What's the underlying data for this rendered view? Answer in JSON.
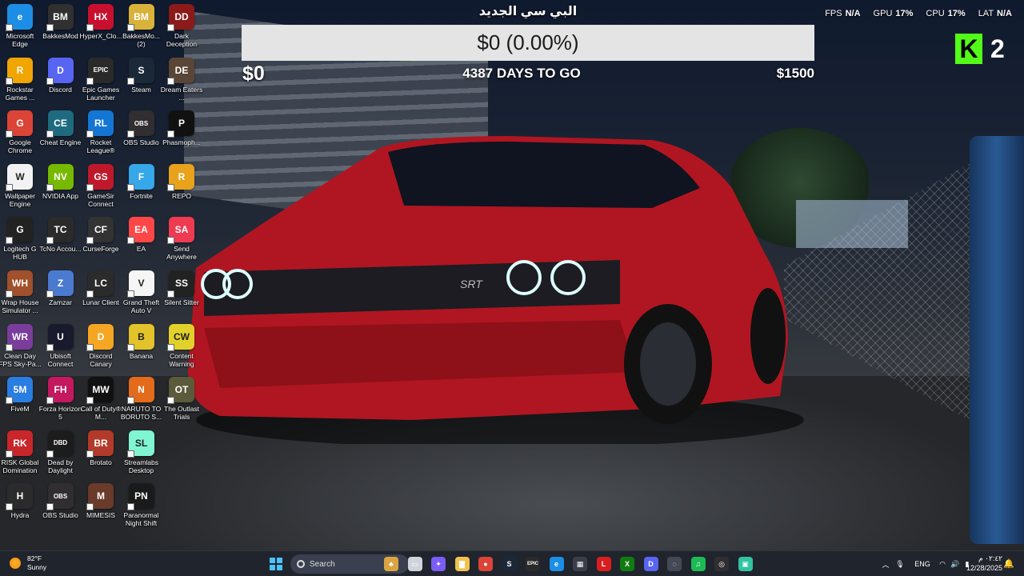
{
  "desktop_icons": [
    {
      "label": "Microsoft Edge",
      "glyph": "e",
      "color": "#1c8ee5",
      "col": 0,
      "row": 0
    },
    {
      "label": "BakkesMod",
      "glyph": "BM",
      "color": "#303030",
      "col": 1,
      "row": 0
    },
    {
      "label": "HyperX_Clo...",
      "glyph": "HX",
      "color": "#c8102e",
      "col": 2,
      "row": 0
    },
    {
      "label": "BakkesMo... (2)",
      "glyph": "BM",
      "color": "#d8b23a",
      "col": 3,
      "row": 0
    },
    {
      "label": "Dark Deception",
      "glyph": "DD",
      "color": "#8b1a1a",
      "col": 4,
      "row": 0
    },
    {
      "label": "Rockstar Games ...",
      "glyph": "R",
      "color": "#f0a500",
      "col": 0,
      "row": 1
    },
    {
      "label": "Discord",
      "glyph": "D",
      "color": "#5865f2",
      "col": 1,
      "row": 1
    },
    {
      "label": "Epic Games Launcher",
      "glyph": "EPIC",
      "color": "#2a2a2a",
      "col": 2,
      "row": 1
    },
    {
      "label": "Steam",
      "glyph": "S",
      "color": "#1b2838",
      "col": 3,
      "row": 1
    },
    {
      "label": "Dream Eaters ...",
      "glyph": "DE",
      "color": "#5a4636",
      "col": 4,
      "row": 1
    },
    {
      "label": "Google Chrome",
      "glyph": "G",
      "color": "#db4437",
      "col": 0,
      "row": 2
    },
    {
      "label": "Cheat Engine",
      "glyph": "CE",
      "color": "#1e6b80",
      "col": 1,
      "row": 2
    },
    {
      "label": "Rocket League®",
      "glyph": "RL",
      "color": "#1476d4",
      "col": 2,
      "row": 2
    },
    {
      "label": "OBS Studio",
      "glyph": "OBS",
      "color": "#302e31",
      "col": 3,
      "row": 2
    },
    {
      "label": "Phasmoph...",
      "glyph": "P",
      "color": "#111111",
      "col": 4,
      "row": 2
    },
    {
      "label": "Wallpaper Engine",
      "glyph": "W",
      "color": "#f2f2f2",
      "col": 0,
      "row": 3
    },
    {
      "label": "NVIDIA App",
      "glyph": "NV",
      "color": "#76b900",
      "col": 1,
      "row": 3
    },
    {
      "label": "GameSir Connect",
      "glyph": "GS",
      "color": "#c0182b",
      "col": 2,
      "row": 3
    },
    {
      "label": "Fortnite",
      "glyph": "F",
      "color": "#36a7e8",
      "col": 3,
      "row": 3
    },
    {
      "label": "REPO",
      "glyph": "R",
      "color": "#e8a21c",
      "col": 4,
      "row": 3
    },
    {
      "label": "Logitech G HUB",
      "glyph": "G",
      "color": "#222222",
      "col": 0,
      "row": 4
    },
    {
      "label": "TcNo Accou...",
      "glyph": "TC",
      "color": "#2b2b2b",
      "col": 1,
      "row": 4
    },
    {
      "label": "CurseForge",
      "glyph": "CF",
      "color": "#333333",
      "col": 2,
      "row": 4
    },
    {
      "label": "EA",
      "glyph": "EA",
      "color": "#ff4747",
      "col": 3,
      "row": 4
    },
    {
      "label": "Send Anywhere",
      "glyph": "SA",
      "color": "#ef3b52",
      "col": 4,
      "row": 4
    },
    {
      "label": "Wrap House Simulator ...",
      "glyph": "WH",
      "color": "#a0502a",
      "col": 0,
      "row": 5
    },
    {
      "label": "Zamzar",
      "glyph": "Z",
      "color": "#4a7bd0",
      "col": 1,
      "row": 5
    },
    {
      "label": "Lunar Client",
      "glyph": "LC",
      "color": "#2b2b2b",
      "col": 2,
      "row": 5
    },
    {
      "label": "Grand Theft Auto V",
      "glyph": "V",
      "color": "#f5f5f5",
      "col": 3,
      "row": 5
    },
    {
      "label": "Silent Sitter",
      "glyph": "SS",
      "color": "#222222",
      "col": 4,
      "row": 5
    },
    {
      "label": "Clean Day FPS Sky-Pa...",
      "glyph": "WR",
      "color": "#7a3d9b",
      "col": 0,
      "row": 6
    },
    {
      "label": "Ubisoft Connect",
      "glyph": "U",
      "color": "#1a1a2e",
      "col": 1,
      "row": 6
    },
    {
      "label": "Discord Canary",
      "glyph": "D",
      "color": "#f5a623",
      "col": 2,
      "row": 6
    },
    {
      "label": "Banana",
      "glyph": "B",
      "color": "#e3c32b",
      "col": 3,
      "row": 6
    },
    {
      "label": "Content Warning",
      "glyph": "CW",
      "color": "#e2d12a",
      "col": 4,
      "row": 6
    },
    {
      "label": "FiveM",
      "glyph": "5M",
      "color": "#2a7de1",
      "col": 0,
      "row": 7
    },
    {
      "label": "Forza Horizon 5",
      "glyph": "FH",
      "color": "#c4195f",
      "col": 1,
      "row": 7
    },
    {
      "label": "Call of Duty® M...",
      "glyph": "MW",
      "color": "#111111",
      "col": 2,
      "row": 7
    },
    {
      "label": "NARUTO TO BORUTO S...",
      "glyph": "N",
      "color": "#e36b1b",
      "col": 3,
      "row": 7
    },
    {
      "label": "The Outlast Trials",
      "glyph": "OT",
      "color": "#5b5b3b",
      "col": 4,
      "row": 7
    },
    {
      "label": "RISK Global Domination",
      "glyph": "RK",
      "color": "#c9262b",
      "col": 0,
      "row": 8
    },
    {
      "label": "Dead by Daylight",
      "glyph": "DBD",
      "color": "#1c1c1c",
      "col": 1,
      "row": 8
    },
    {
      "label": "Brotato",
      "glyph": "BR",
      "color": "#b23a2a",
      "col": 2,
      "row": 8
    },
    {
      "label": "Streamlabs Desktop",
      "glyph": "SL",
      "color": "#80f5d2",
      "col": 3,
      "row": 8
    },
    {
      "label": "Hydra",
      "glyph": "H",
      "color": "#2b2b2b",
      "col": 0,
      "row": 9
    },
    {
      "label": "OBS Studio",
      "glyph": "OBS",
      "color": "#302e31",
      "col": 1,
      "row": 9
    },
    {
      "label": "MIMESIS",
      "glyph": "M",
      "color": "#6a3a2a",
      "col": 2,
      "row": 9
    },
    {
      "label": "Paranormal Night Shift",
      "glyph": "PN",
      "color": "#1a1a1a",
      "col": 3,
      "row": 9
    }
  ],
  "goal": {
    "title": "البي سي الجديد",
    "current_label": "$0 (0.00%)",
    "progress_fraction": 0,
    "min_label": "$0",
    "countdown": "4387 DAYS TO GO",
    "max_label": "$1500",
    "fill_color": "#53fc18"
  },
  "stats": {
    "fps_label": "FPS",
    "fps_value": "N/A",
    "gpu_label": "GPU",
    "gpu_value": "17%",
    "cpu_label": "CPU",
    "cpu_value": "17%",
    "lat_label": "LAT",
    "lat_value": "N/A"
  },
  "kick": {
    "logo": "K",
    "count": "2",
    "accent": "#53fc18"
  },
  "taskbar": {
    "weather": {
      "temp": "82°F",
      "condition": "Sunny"
    },
    "search_placeholder": "Search",
    "pinned_apps": [
      {
        "name": "widgets-icon",
        "glyph": "♣",
        "color": "#d9a441"
      },
      {
        "name": "task-view-icon",
        "glyph": "▭",
        "color": "#cfd3dc"
      },
      {
        "name": "copilot-icon",
        "glyph": "✦",
        "color": "#7b5cf5"
      },
      {
        "name": "file-explorer-icon",
        "glyph": "▇",
        "color": "#f2c14e"
      },
      {
        "name": "chrome-icon",
        "glyph": "●",
        "color": "#db4437"
      },
      {
        "name": "steam-icon",
        "glyph": "S",
        "color": "#1b2838"
      },
      {
        "name": "epic-games-icon",
        "glyph": "EPIC",
        "color": "#2a2a2a"
      },
      {
        "name": "edge-icon",
        "glyph": "e",
        "color": "#1c8ee5"
      },
      {
        "name": "microsoft-store-icon",
        "glyph": "▦",
        "color": "#3a3f4a"
      },
      {
        "name": "l-app-icon",
        "glyph": "L",
        "color": "#d81e1e"
      },
      {
        "name": "xbox-icon",
        "glyph": "X",
        "color": "#107c10"
      },
      {
        "name": "discord-icon",
        "glyph": "D",
        "color": "#5865f2"
      },
      {
        "name": "app-icon",
        "glyph": "◌",
        "color": "#444a55"
      },
      {
        "name": "spotify-icon",
        "glyph": "♫",
        "color": "#1db954"
      },
      {
        "name": "obs-icon",
        "glyph": "◎",
        "color": "#302e31"
      },
      {
        "name": "streamlabs-icon",
        "glyph": "▣",
        "color": "#31c3a2"
      }
    ],
    "language": "ENG",
    "time": "٠٢:٤٢ م",
    "date": "12/28/2025"
  }
}
